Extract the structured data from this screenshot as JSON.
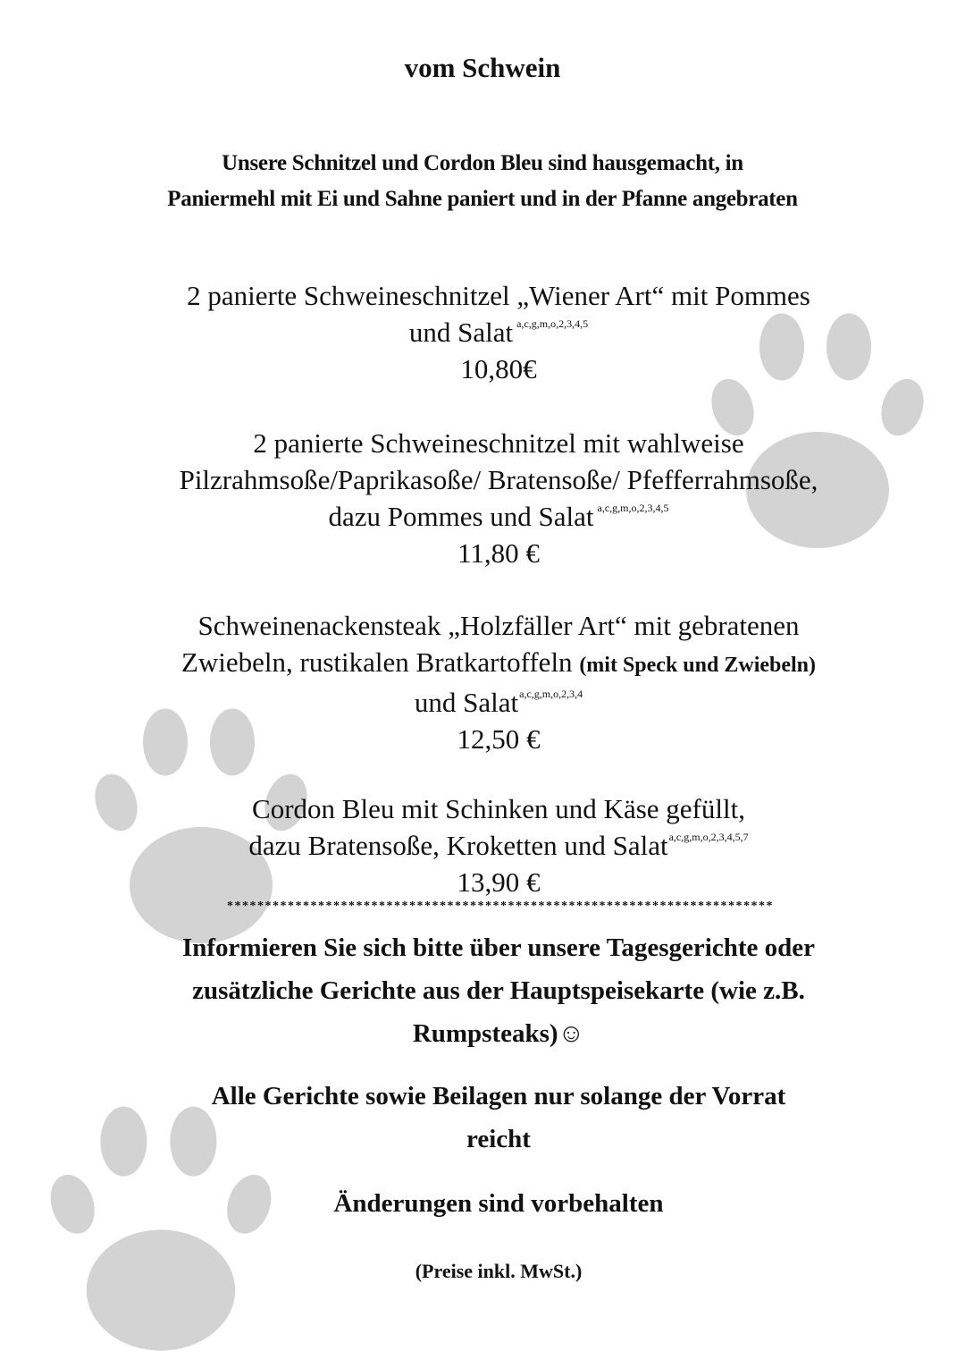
{
  "title": "vom Schwein",
  "intro": {
    "line1": "Unsere Schnitzel und Cordon Bleu sind hausgemacht, in",
    "line2": "Paniermehl mit Ei und Sahne paniert und in der Pfanne angebraten"
  },
  "dishes": [
    {
      "line1": "2 panierte Schweineschnitzel „Wiener Art“ mit Pommes",
      "line2": "und Salat",
      "allergens": "a,c,g,m,o,2,3,4,5",
      "price": "10,80€"
    },
    {
      "line1": "2 panierte Schweineschnitzel mit wahlweise",
      "line2": "Pilzrahmsoße/Paprikasoße/ Bratensoße/ Pfefferrahmsoße,",
      "line3": "dazu Pommes und Salat",
      "allergens": "a,c,g,m,o,2,3,4,5",
      "price": "11,80 €"
    },
    {
      "line1": "Schweinenackensteak  „Holzfäller Art“ mit gebratenen",
      "line2": "Zwiebeln, rustikalen Bratkartoffeln",
      "line2_note": "(mit Speck und Zwiebeln)",
      "line3": "und Salat",
      "allergens": "a,c,g,m,o,2,3,4",
      "price": "12,50 €"
    },
    {
      "line1": "Cordon Bleu mit Schinken und Käse gefüllt,",
      "line2": "dazu Bratensoße, Kroketten und Salat",
      "allergens": "a,c,g,m,o,2,3,4,5,7",
      "price": "13,90 €"
    }
  ],
  "separator": "************************************************************************",
  "notices": {
    "daily_line1": "Informieren Sie sich bitte über unsere Tagesgerichte oder",
    "daily_line2": "zusätzliche Gerichte aus der Hauptspeisekarte (wie z.B.",
    "daily_line3": "Rumpsteaks)☺",
    "stock_line1": "Alle Gerichte sowie Beilagen nur solange der Vorrat",
    "stock_line2": "reicht",
    "changes": "Änderungen sind vorbehalten",
    "prices": "(Preise inkl. MwSt.)"
  },
  "colors": {
    "background": "#ffffff",
    "text": "#111111",
    "paw": "#d3d3d3"
  },
  "icons": [
    "paw-print-icon",
    "smiley-face-icon"
  ]
}
